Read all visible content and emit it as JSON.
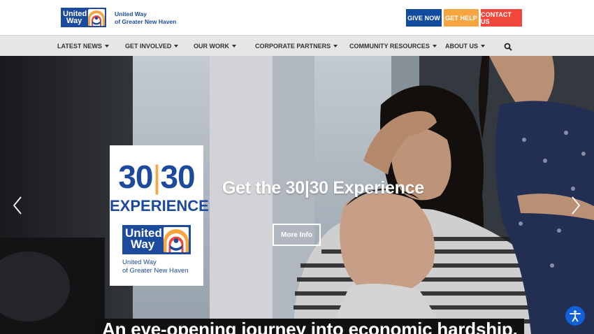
{
  "header": {
    "logo_text_line1": "United",
    "logo_text_line2": "Way",
    "org_line1": "United Way",
    "org_line2": "of Greater New Haven",
    "buttons": {
      "give_now": "GIVE NOW",
      "get_help": "GET HELP",
      "contact_us": "CONTACT US"
    },
    "colors": {
      "brand_blue": "#1c4a9c",
      "give": "#104b9e",
      "help": "#f7a541",
      "contact": "#f0463c"
    }
  },
  "nav": {
    "items": [
      {
        "label": "LATEST NEWS"
      },
      {
        "label": "GET INVOLVED"
      },
      {
        "label": "OUR WORK"
      },
      {
        "label": "CORPORATE PARTNERS"
      },
      {
        "label": "COMMUNITY RESOURCES"
      },
      {
        "label": "ABOUT US"
      }
    ],
    "search_icon": "search-icon"
  },
  "hero": {
    "badge": {
      "number_left": "30",
      "number_right": "30",
      "divider": "|",
      "experience": "EXPERIENCE",
      "logo_line1": "United",
      "logo_line2": "Way",
      "org_line1": "United Way",
      "org_line2": "of Greater New Haven"
    },
    "title": "Get the 30|30 Experience",
    "button": "More Info",
    "caption": "An eye-opening journey into economic hardship.",
    "prev_icon": "chevron-left-icon",
    "next_icon": "chevron-right-icon"
  },
  "accessibility": {
    "icon": "accessibility-icon"
  }
}
